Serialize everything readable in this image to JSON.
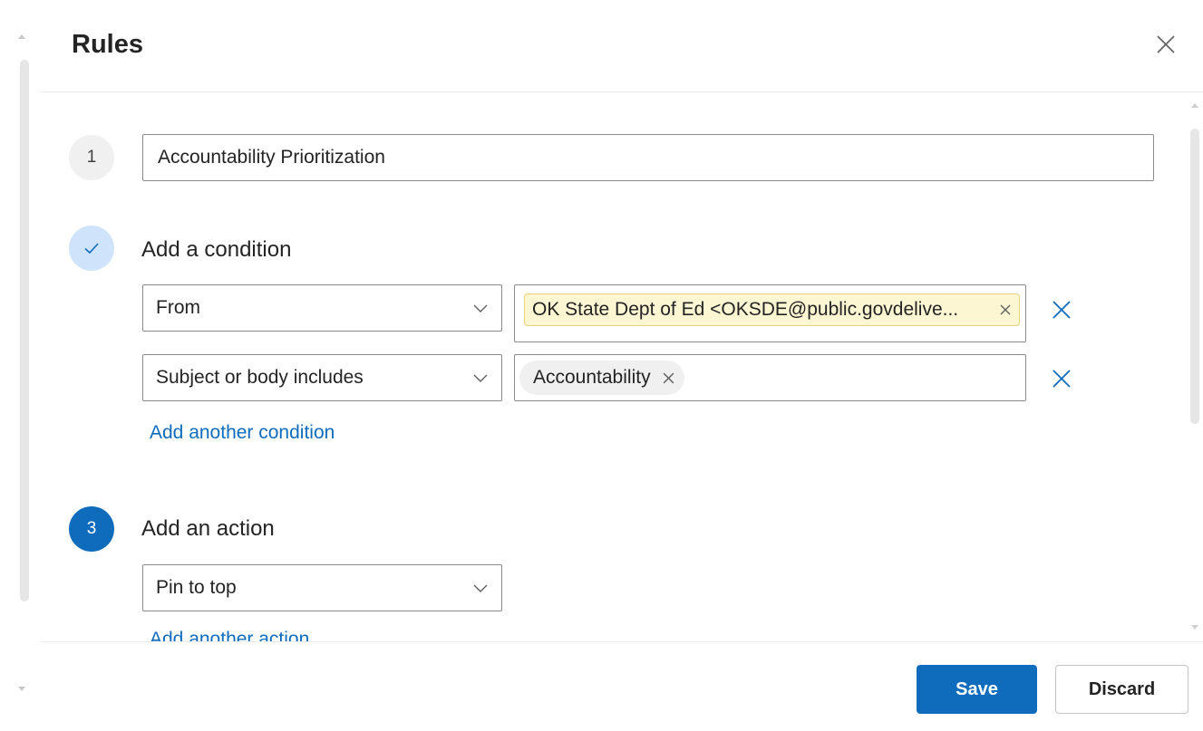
{
  "dialog": {
    "title": "Rules",
    "close_icon": "close-icon"
  },
  "steps": {
    "step1_number": "1",
    "rule_name_value": "Accountability Prioritization",
    "step2_icon": "checkmark-icon",
    "step2_title": "Add a condition",
    "step3_number": "3",
    "step3_title": "Add an action"
  },
  "conditions": [
    {
      "type": "From",
      "value": "OK State Dept of Ed <OKSDE@public.govdelive...",
      "chip_style": "highlighted"
    },
    {
      "type": "Subject or body includes",
      "value": "Accountability",
      "chip_style": "pill"
    }
  ],
  "add_condition_label": "Add another condition",
  "actions": [
    {
      "type": "Pin to top"
    }
  ],
  "add_action_label": "Add another action",
  "footer": {
    "save_label": "Save",
    "discard_label": "Discard"
  },
  "colors": {
    "accent": "#0f6cbd",
    "chip_highlight": "#fdf6d3",
    "chip_pill": "#f0f0f0",
    "step_complete_bg": "#cfe4fa"
  }
}
